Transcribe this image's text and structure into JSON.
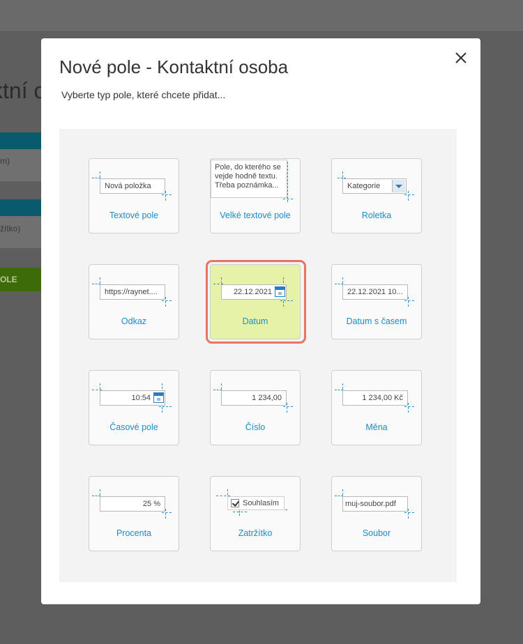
{
  "background": {
    "heading": "ktní o",
    "row1_text": "m)",
    "row2_text": "žítko)",
    "green_button": "OLE"
  },
  "modal": {
    "title": "Nové pole - Kontaktní osoba",
    "subtitle": "Vyberte typ pole, které chcete přidat...",
    "close_icon": "close-icon"
  },
  "colors": {
    "accent": "#1d8bc4",
    "selected_bg": "#e6f2a8",
    "selected_ring": "#e8735e",
    "guide_lines": "#2a8ac4"
  },
  "field_types": [
    {
      "label": "Textové pole",
      "preview": "Nová položka"
    },
    {
      "label": "Velké textové pole",
      "preview": "Pole, do kterého se vejde hodně textu. Třeba poznámka..."
    },
    {
      "label": "Roletka",
      "preview": "Kategorie"
    },
    {
      "label": "Odkaz",
      "preview": "https://raynet...."
    },
    {
      "label": "Datum",
      "preview": "22.12.2021",
      "selected": true
    },
    {
      "label": "Datum s časem",
      "preview": "22.12.2021 10..."
    },
    {
      "label": "Časové pole",
      "preview": "10:54"
    },
    {
      "label": "Číslo",
      "preview": "1 234,00"
    },
    {
      "label": "Měna",
      "preview": "1 234,00 Kč"
    },
    {
      "label": "Procenta",
      "preview": "25 %"
    },
    {
      "label": "Zatržítko",
      "preview": "Souhlasím"
    },
    {
      "label": "Soubor",
      "preview": "muj-soubor.pdf"
    }
  ]
}
